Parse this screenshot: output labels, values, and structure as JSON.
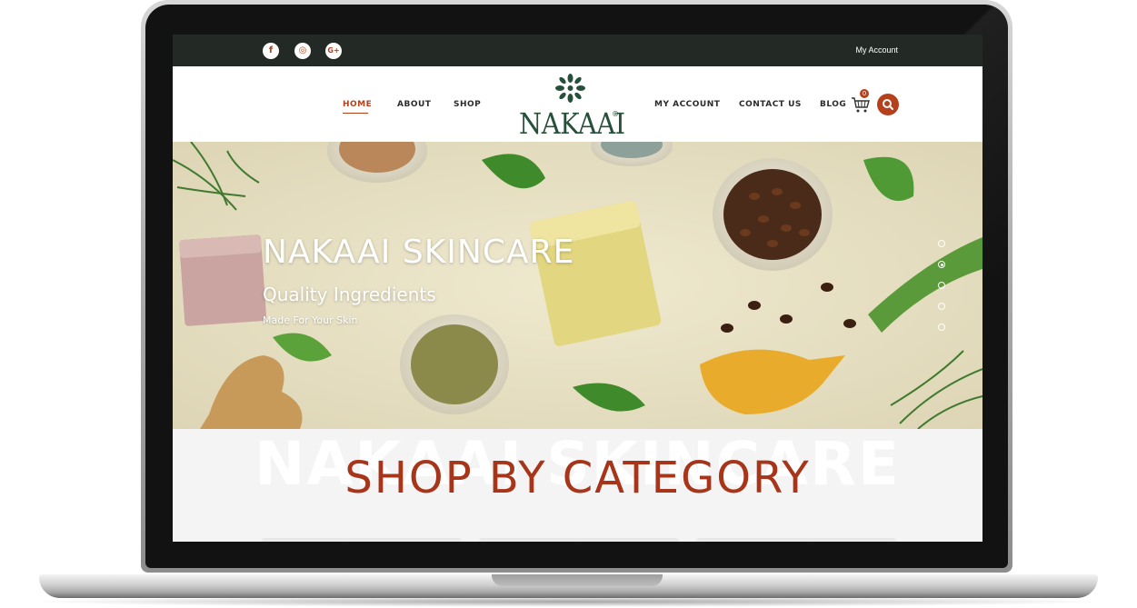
{
  "topbar": {
    "social": [
      {
        "icon": "facebook-icon",
        "glyph": "f"
      },
      {
        "icon": "instagram-icon",
        "glyph": "◎"
      },
      {
        "icon": "google-plus-icon",
        "glyph": "G+"
      }
    ],
    "my_account": "My Account"
  },
  "nav": {
    "home": "HOME",
    "about": "ABOUT",
    "shop": "SHOP",
    "my_account": "MY ACCOUNT",
    "contact": "CONTACT US",
    "blog": "BLOG",
    "cart_count": "0"
  },
  "logo": {
    "text": "NAKAAI",
    "reg": "®"
  },
  "hero": {
    "title": "NAKAAI SKINCARE",
    "subtitle": "Quality Ingredients",
    "tagline": "Made For Your Skin",
    "slides": 5,
    "active_slide": 2
  },
  "category": {
    "watermark": "NAKAAI SKINCARE",
    "title": "SHOP BY CATEGORY"
  },
  "colors": {
    "accent": "#b5401b",
    "topbar": "#232a25",
    "brand_green": "#27503b",
    "hero_bg": "#e8e2c8"
  }
}
